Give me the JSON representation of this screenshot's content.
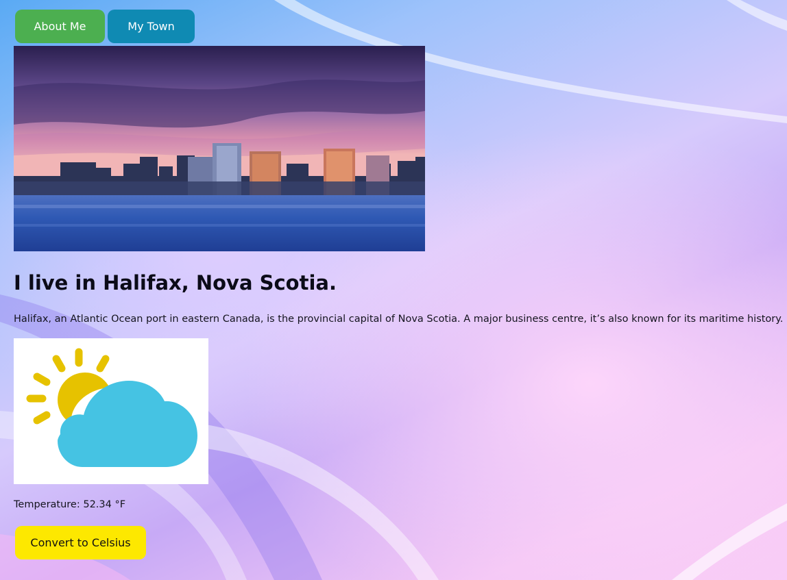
{
  "nav": {
    "about_label": "About Me",
    "town_label": "My Town"
  },
  "hero": {
    "image": "halifax-skyline-photo"
  },
  "main": {
    "heading": "I live in Halifax, Nova Scotia.",
    "description": "Halifax, an Atlantic Ocean port in eastern Canada, is the provincial capital of Nova Scotia. A major business centre, it’s also known for its maritime history."
  },
  "weather": {
    "icon": "partly-cloudy-icon",
    "temperature_text": "Temperature: 52.34 °F",
    "convert_label": "Convert to Celsius"
  },
  "colors": {
    "about_button": "#4caf50",
    "town_button": "#0f8ab3",
    "convert_button": "#fde800",
    "sun": "#e6c200",
    "cloud": "#45c3e3"
  }
}
